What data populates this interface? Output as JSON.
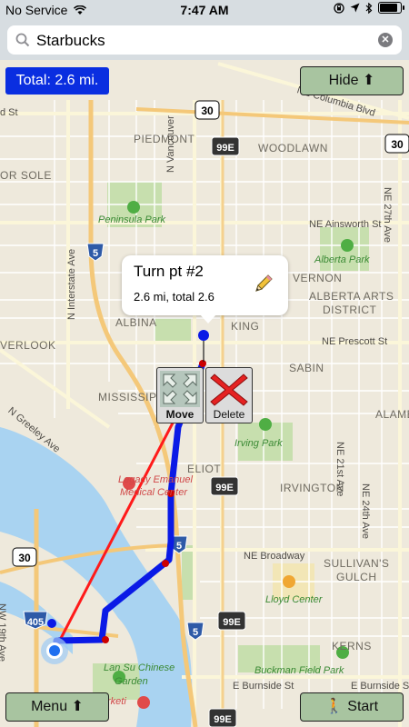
{
  "status_bar": {
    "carrier": "No Service",
    "time": "7:47 AM",
    "battery_level": 0.9
  },
  "search": {
    "value": "Starbucks",
    "placeholder": ""
  },
  "total_badge": "Total: 2.6 mi.",
  "hide_button": "Hide ⬆",
  "menu_button": "Menu ⬆",
  "start_button": "🚶 Start",
  "callout": {
    "title": "Turn pt #2",
    "subtitle": "2.6 mi, total 2.6"
  },
  "tools": {
    "move": "Move",
    "delete": "Delete"
  },
  "map": {
    "districts": [
      "PIEDMONT",
      "WOODLAWN",
      "VERNON",
      "ALBERTA ARTS",
      "DISTRICT",
      "ALBINA",
      "KING",
      "SABIN",
      "MISSISSIPPI",
      "ELIOT",
      "IRVINGTON",
      "SULLIVAN'S",
      "GULCH",
      "KERNS",
      "ALAME",
      "OR SOLE",
      "VERLOOK"
    ],
    "streets": [
      "NE Columbia Blvd",
      "N Vancouver",
      "N Interstate Ave",
      "NE Ainsworth St",
      "NE Prescott St",
      "N Greeley Ave",
      "NE Broadway",
      "NE 27th Ave",
      "NE 21st Ave",
      "NE 24th Ave",
      "E Burnside St",
      "NW 19th Ave",
      "E Burnside St",
      "d St"
    ],
    "parks": [
      "Peninsula Park",
      "Alberta Park",
      "Irving Park",
      "Lloyd Center",
      "Buckman Field Park",
      "Lan Su Chinese",
      "Garden",
      "Legacy Emanuel",
      "Medical Center",
      "rketi"
    ],
    "shields": [
      "30",
      "99E",
      "30",
      "5",
      "99E",
      "5",
      "405",
      "5",
      "99E",
      "30",
      "99E"
    ],
    "colors": {
      "route_planned": "#0a1ae6",
      "route_direct": "#ff1a1a",
      "turn_point": "#cc0000"
    }
  }
}
